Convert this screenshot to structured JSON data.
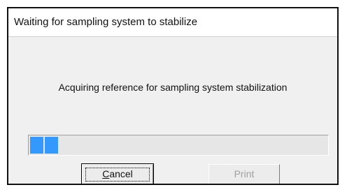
{
  "window": {
    "title": "Waiting for sampling system to stabilize"
  },
  "message": "Acquiring reference for sampling system stabilization",
  "progress": {
    "blocks_filled": 2
  },
  "buttons": {
    "cancel": {
      "mnemonic": "C",
      "rest": "ancel",
      "enabled": true
    },
    "print": {
      "label": "Print",
      "enabled": false
    }
  },
  "colors": {
    "progress_fill": "#3399ff",
    "dialog_background": "#f0f0f0",
    "disabled_text": "#a0a0a0"
  }
}
